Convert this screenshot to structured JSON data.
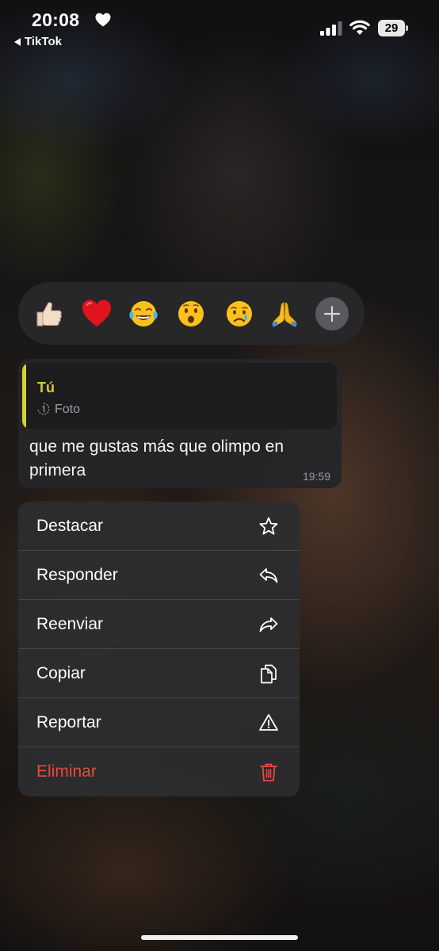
{
  "status_bar": {
    "time": "20:08",
    "back_app": "TikTok",
    "battery_level": "29"
  },
  "reactions": [
    {
      "icon": "thumbs-up-light-skin-emoji"
    },
    {
      "icon": "red-heart-emoji"
    },
    {
      "icon": "tears-of-joy-emoji"
    },
    {
      "icon": "surprised-face-emoji"
    },
    {
      "icon": "crying-face-emoji"
    },
    {
      "icon": "folded-hands-emoji"
    }
  ],
  "message": {
    "quote_author": "Tú",
    "quote_type": "Foto",
    "text": "que me gustas más que olimpo en primera",
    "time": "19:59"
  },
  "menu": {
    "items": [
      {
        "label": "Destacar",
        "icon": "star-icon"
      },
      {
        "label": "Responder",
        "icon": "reply-icon"
      },
      {
        "label": "Reenviar",
        "icon": "forward-icon"
      },
      {
        "label": "Copiar",
        "icon": "copy-icon"
      },
      {
        "label": "Reportar",
        "icon": "warning-icon"
      },
      {
        "label": "Eliminar",
        "icon": "trash-icon"
      }
    ]
  },
  "colors": {
    "quote_accent": "#d7d22c",
    "danger": "#ea4a3a"
  }
}
